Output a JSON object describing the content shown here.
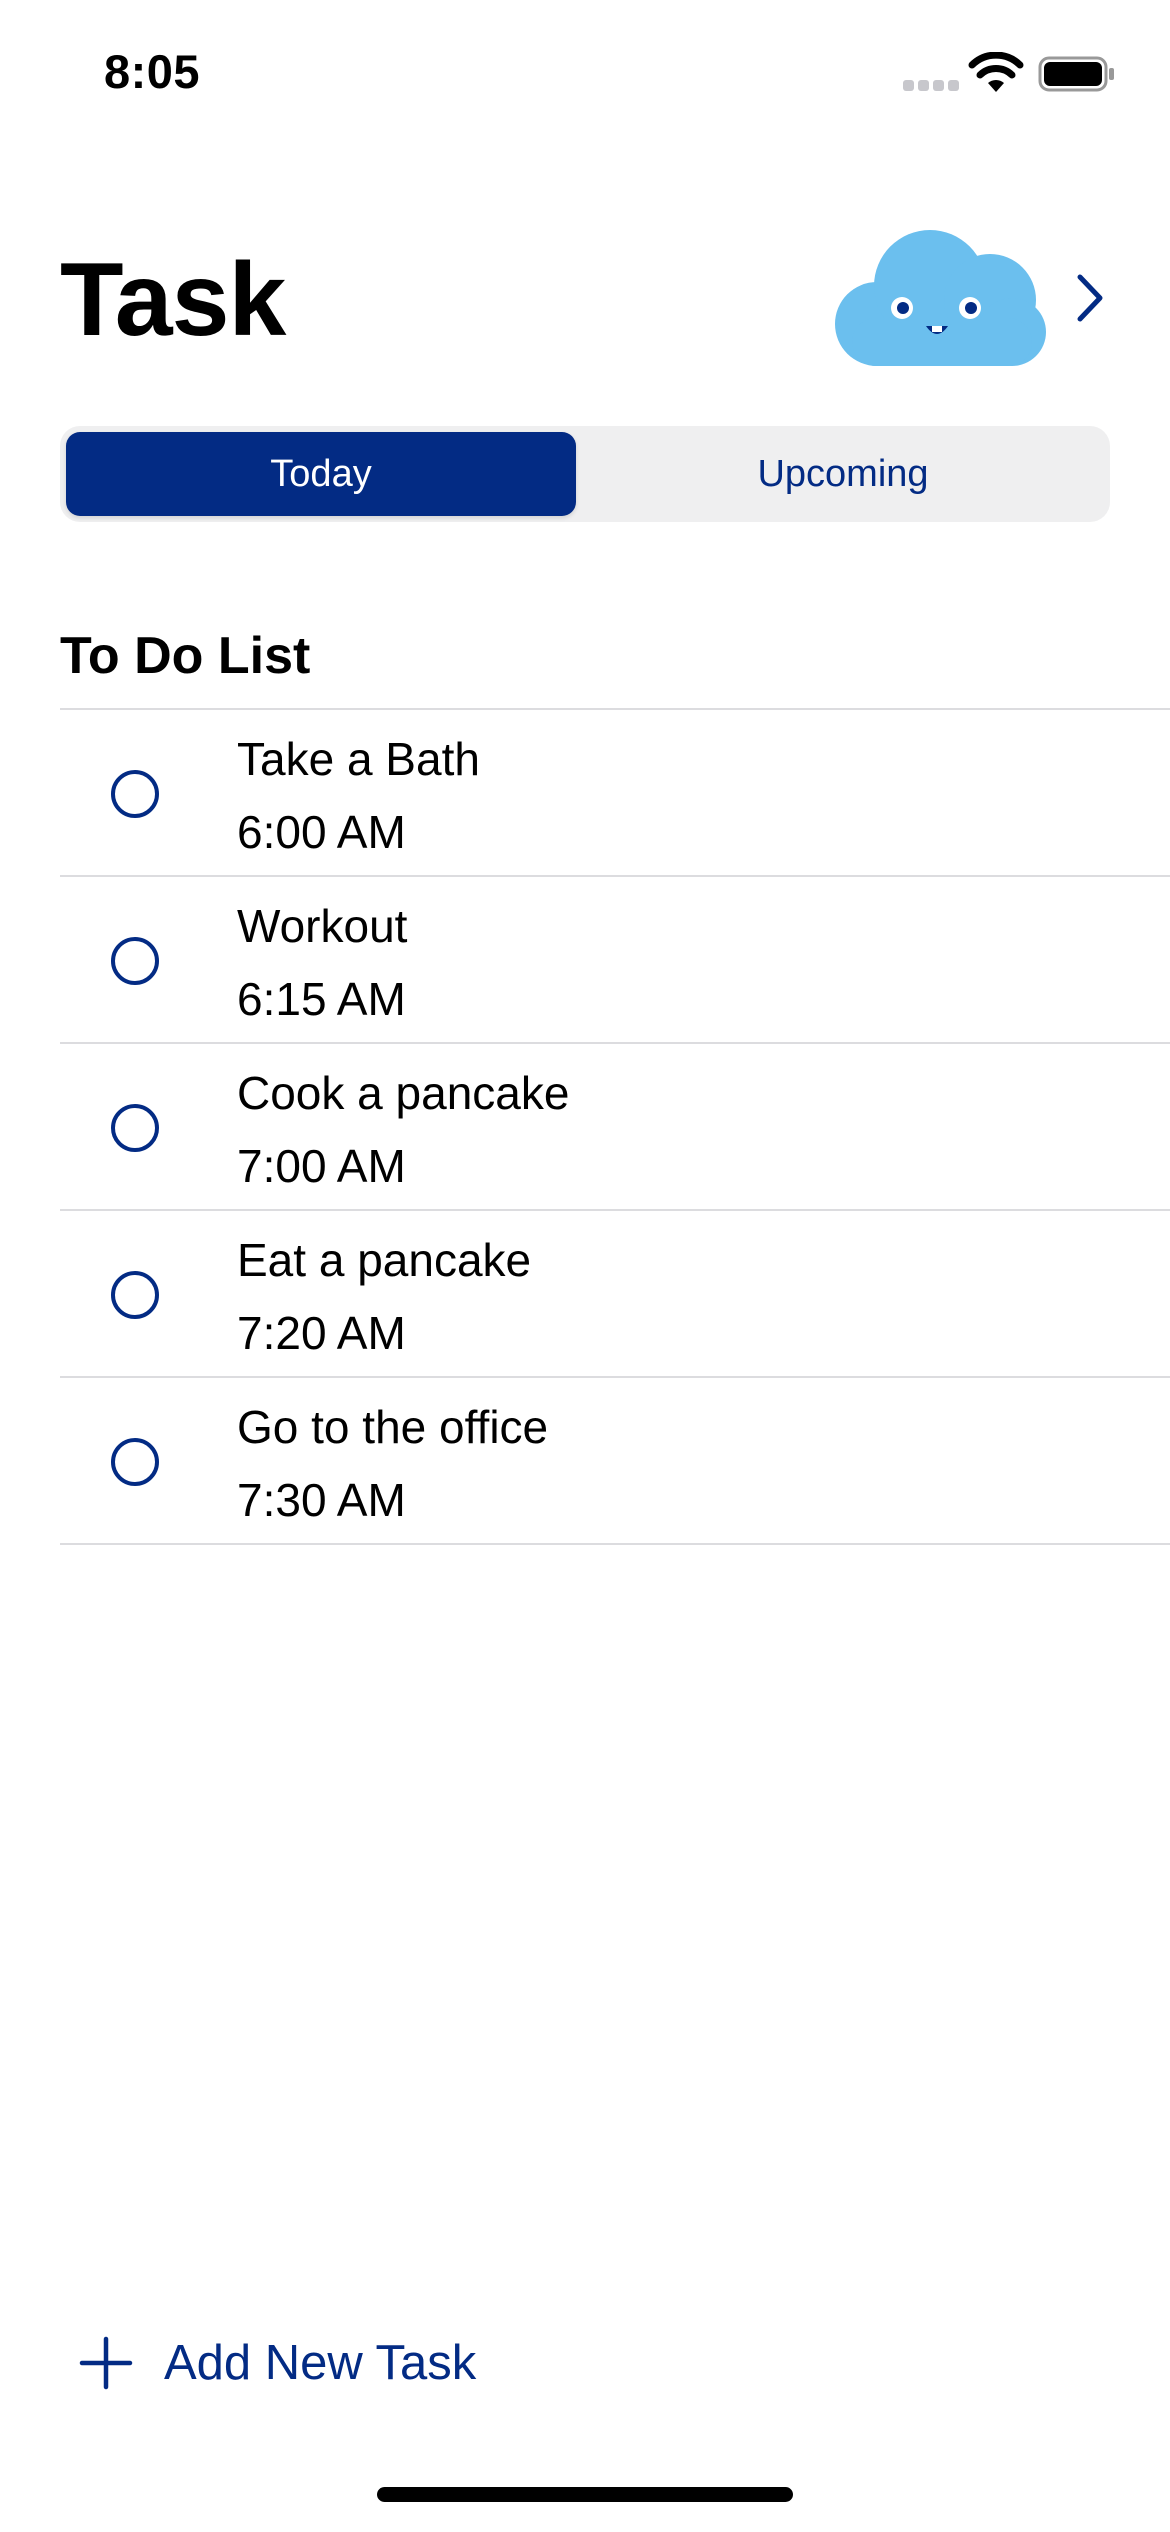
{
  "status_bar": {
    "time": "8:05"
  },
  "header": {
    "title": "Task",
    "avatar_icon": "cloud-mascot-icon",
    "chevron_icon": "chevron-right-icon"
  },
  "tabs": {
    "items": [
      {
        "label": "Today",
        "selected": true
      },
      {
        "label": "Upcoming",
        "selected": false
      }
    ]
  },
  "section": {
    "title": "To Do List"
  },
  "tasks": [
    {
      "name": "Take a Bath",
      "time": "6:00 AM",
      "done": false
    },
    {
      "name": "Workout",
      "time": "6:15 AM",
      "done": false
    },
    {
      "name": "Cook a pancake",
      "time": "7:00 AM",
      "done": false
    },
    {
      "name": "Eat a pancake",
      "time": "7:20 AM",
      "done": false
    },
    {
      "name": "Go to the office",
      "time": "7:30 AM",
      "done": false
    }
  ],
  "footer": {
    "add_label": "Add New Task",
    "add_icon": "plus-icon"
  },
  "colors": {
    "accent": "#032b84",
    "cloud": "#6bbfee",
    "segment_bg": "#efeff0",
    "divider": "#dcdcdf"
  }
}
